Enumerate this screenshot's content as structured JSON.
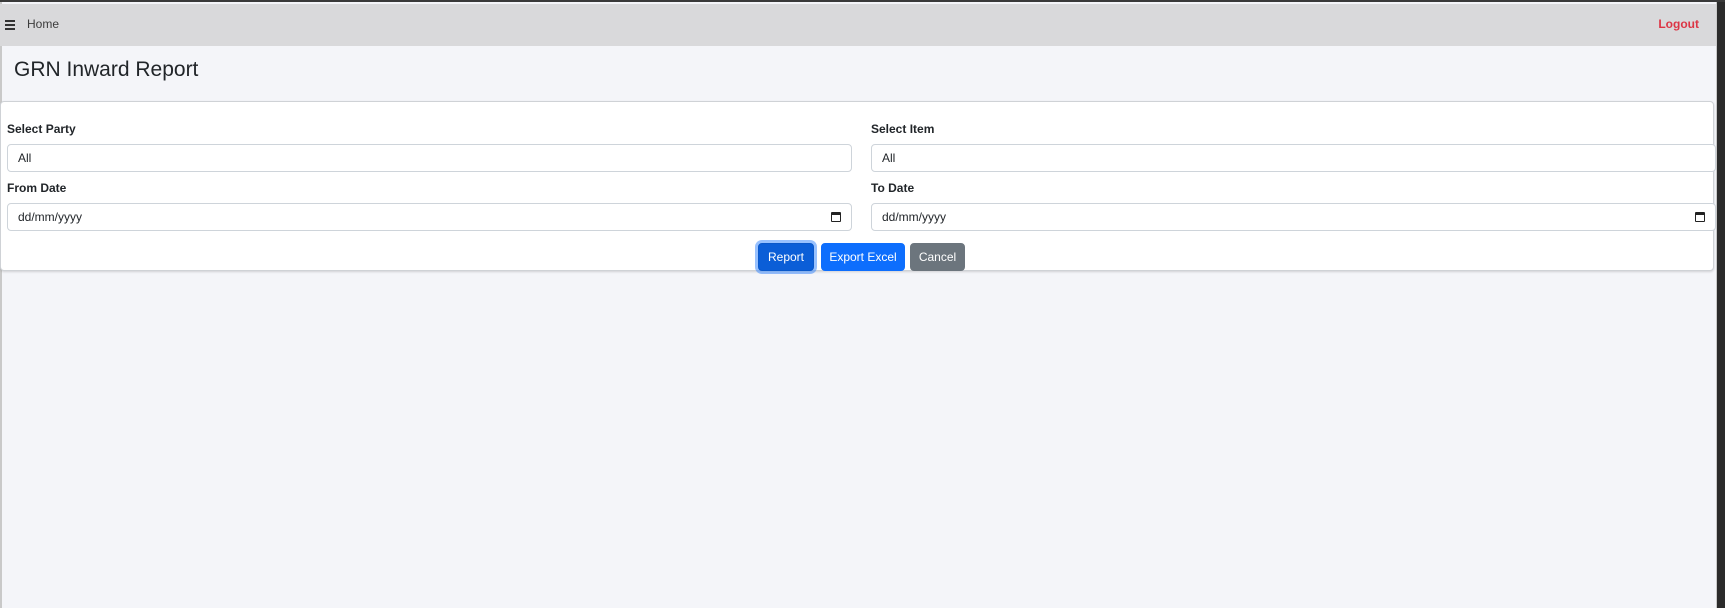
{
  "navbar": {
    "home_label": "Home",
    "logout_label": "Logout",
    "menu_icon": "hamburger-menu-icon",
    "logout_color": "#dc3545"
  },
  "page": {
    "title": "GRN Inward Report"
  },
  "form": {
    "party": {
      "label": "Select Party",
      "value": "All"
    },
    "item": {
      "label": "Select Item",
      "value": "All"
    },
    "from_date": {
      "label": "From Date",
      "placeholder": "dd/mm/yyyy",
      "icon": "calendar-icon"
    },
    "to_date": {
      "label": "To Date",
      "placeholder": "dd/mm/yyyy",
      "icon": "calendar-icon"
    }
  },
  "actions": {
    "report_label": "Report",
    "export_label": "Export Excel",
    "cancel_label": "Cancel",
    "primary_color": "#0d6efd",
    "secondary_color": "#6c757d"
  }
}
